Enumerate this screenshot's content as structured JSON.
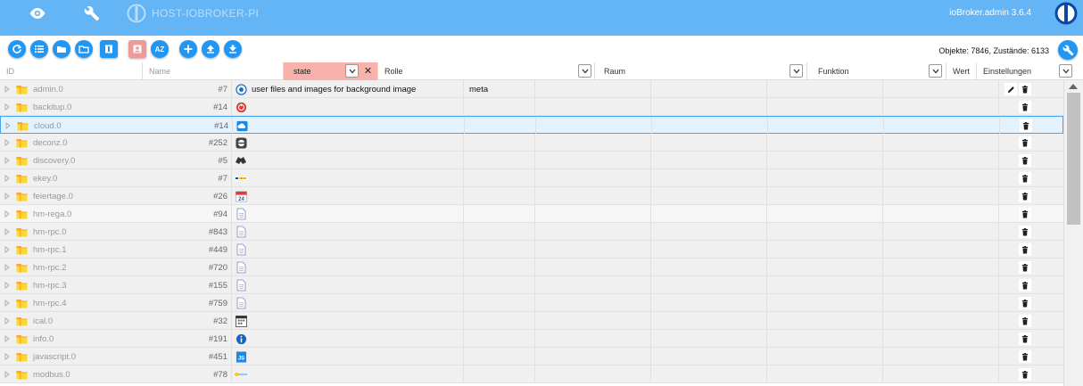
{
  "header": {
    "host_name": "HOST-IOBROKER-PI",
    "admin_version": "ioBroker.admin 3.6.4",
    "nav": [
      {
        "name": "eye-icon"
      },
      {
        "name": "wrench-icon"
      }
    ],
    "colors": {
      "bar": "#64b5f6",
      "accent": "#2196f3",
      "active_filter": "#f8b2ab"
    }
  },
  "toolbar": {
    "buttons": [
      "refresh-icon",
      "list-view-icon",
      "folder-icon",
      "folder-open-icon",
      "page-icon",
      "user-icon",
      "sort-az-icon",
      "add-icon",
      "upload-icon",
      "download-icon"
    ],
    "sort_label": "AZ",
    "objects_count": "Objekte: 7846, Zustände: 6133"
  },
  "filters": {
    "id_placeholder": "ID",
    "name_placeholder": "Name",
    "type_value": "state",
    "role_value": "Rolle",
    "room_value": "Raum",
    "function_value": "Funktion",
    "value_label": "Wert",
    "settings_value": "Einstellungen"
  },
  "rows": [
    {
      "id": "admin.0",
      "count": "#7",
      "icon": "admin-gear-icon",
      "name": "user files and images for background image",
      "role": "meta",
      "edit": true
    },
    {
      "id": "backitup.0",
      "count": "#14",
      "icon": "backitup-icon",
      "name": "",
      "role": "",
      "edit": false
    },
    {
      "id": "cloud.0",
      "count": "#14",
      "icon": "cloud-icon",
      "name": "",
      "role": "",
      "edit": false
    },
    {
      "id": "deconz.0",
      "count": "#252",
      "icon": "deconz-icon",
      "name": "",
      "role": "",
      "edit": false
    },
    {
      "id": "discovery.0",
      "count": "#5",
      "icon": "binoculars-icon",
      "name": "",
      "role": "",
      "edit": false
    },
    {
      "id": "ekey.0",
      "count": "#7",
      "icon": "ekey-icon",
      "name": "",
      "role": "",
      "edit": false
    },
    {
      "id": "feiertage.0",
      "count": "#26",
      "icon": "calendar-24-icon",
      "name": "",
      "role": "",
      "edit": false
    },
    {
      "id": "hm-rega.0",
      "count": "#94",
      "icon": "document-icon",
      "name": "",
      "role": "",
      "edit": false
    },
    {
      "id": "hm-rpc.0",
      "count": "#843",
      "icon": "document-icon",
      "name": "",
      "role": "",
      "edit": false
    },
    {
      "id": "hm-rpc.1",
      "count": "#449",
      "icon": "document-icon",
      "name": "",
      "role": "",
      "edit": false
    },
    {
      "id": "hm-rpc.2",
      "count": "#720",
      "icon": "document-icon",
      "name": "",
      "role": "",
      "edit": false
    },
    {
      "id": "hm-rpc.3",
      "count": "#155",
      "icon": "document-icon",
      "name": "",
      "role": "",
      "edit": false
    },
    {
      "id": "hm-rpc.4",
      "count": "#759",
      "icon": "document-icon",
      "name": "",
      "role": "",
      "edit": false
    },
    {
      "id": "ical.0",
      "count": "#32",
      "icon": "ical-icon",
      "name": "",
      "role": "",
      "edit": false
    },
    {
      "id": "info.0",
      "count": "#191",
      "icon": "info-icon",
      "name": "",
      "role": "",
      "edit": false
    },
    {
      "id": "javascript.0",
      "count": "#451",
      "icon": "javascript-icon",
      "name": "",
      "role": "",
      "edit": false
    },
    {
      "id": "modbus.0",
      "count": "#78",
      "icon": "modbus-icon",
      "name": "",
      "role": "",
      "edit": false
    }
  ],
  "selected_row": 2
}
